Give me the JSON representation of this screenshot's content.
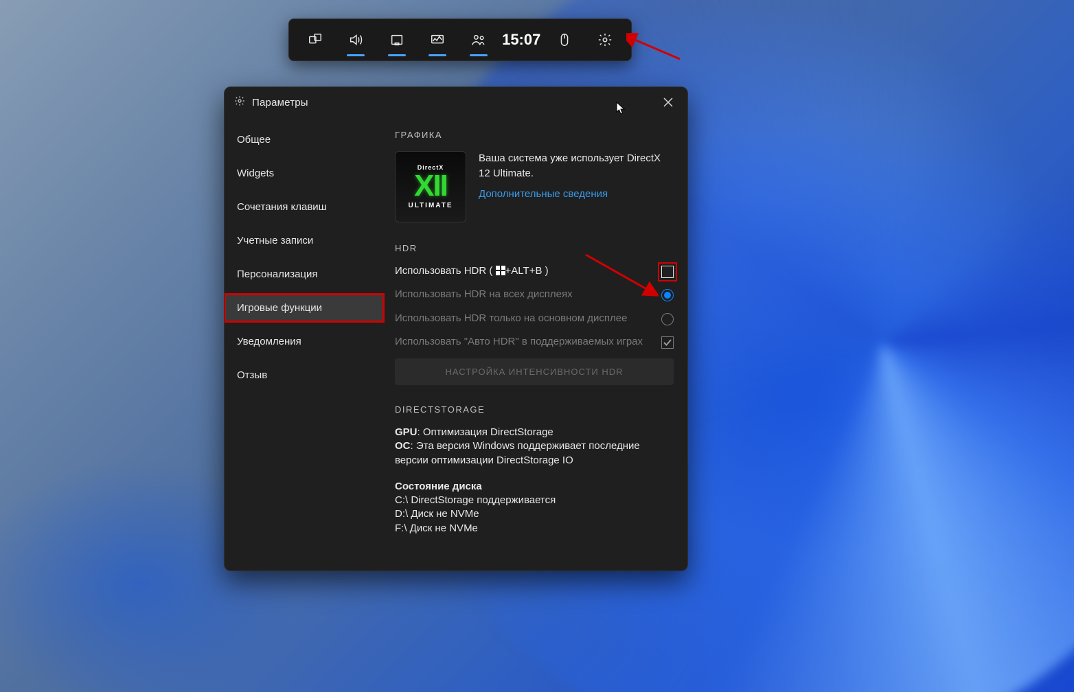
{
  "gamebar": {
    "time": "15:07"
  },
  "panel": {
    "title": "Параметры"
  },
  "sidebar": {
    "items": [
      {
        "label": "Общее"
      },
      {
        "label": "Widgets"
      },
      {
        "label": "Сочетания клавиш"
      },
      {
        "label": "Учетные записи"
      },
      {
        "label": "Персонализация"
      },
      {
        "label": "Игровые функции"
      },
      {
        "label": "Уведомления"
      },
      {
        "label": "Отзыв"
      }
    ]
  },
  "graphics": {
    "title": "ГРАФИКА",
    "dx_line1": "DirectX",
    "dx_line2": "XII",
    "dx_line3": "ULTIMATE",
    "status": "Ваша система уже использует DirectX 12 Ultimate.",
    "more_link": "Дополнительные сведения"
  },
  "hdr": {
    "title": "HDR",
    "use_hdr_prefix": "Использовать HDR ( ",
    "use_hdr_suffix": "+ALT+B )",
    "all_displays": "Использовать HDR на всех дисплеях",
    "main_display": "Использовать HDR только на основном дисплее",
    "auto_hdr": "Использовать \"Авто HDR\" в поддерживаемых играх",
    "intensity_btn": "НАСТРОЙКА ИНТЕНСИВНОСТИ HDR"
  },
  "directstorage": {
    "title": "DIRECTSTORAGE",
    "gpu_label": "GPU",
    "gpu_text": ": Оптимизация DirectStorage",
    "os_label": "ОС",
    "os_text": ": Эта версия Windows поддерживает последние версии оптимизации DirectStorage IO",
    "disk_title": "Состояние диска",
    "disk_c": "C:\\ DirectStorage поддерживается",
    "disk_d": "D:\\ Диск не NVMe",
    "disk_f": "F:\\ Диск не NVMe"
  }
}
